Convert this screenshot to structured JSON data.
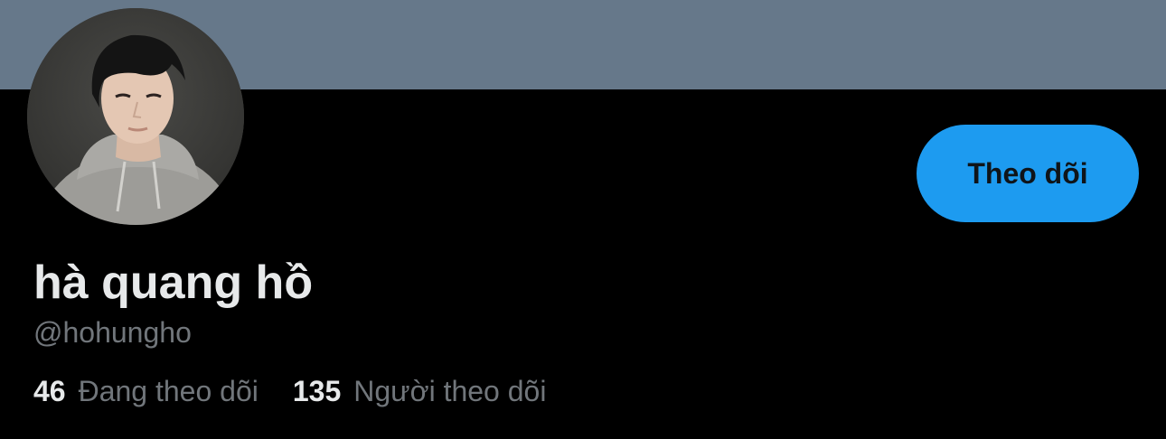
{
  "profile": {
    "display_name": "hà quang hồ",
    "username": "@hohungho",
    "follow_button_label": "Theo dõi",
    "avatar": "profile-photo",
    "stats": {
      "following_count": "46",
      "following_label": "Đang theo dõi",
      "followers_count": "135",
      "followers_label": "Người theo dõi"
    }
  },
  "colors": {
    "banner": "#66788a",
    "background": "#000000",
    "accent": "#1d9bf0",
    "primary_text": "#e7e9ea",
    "secondary_text": "#71767b"
  }
}
